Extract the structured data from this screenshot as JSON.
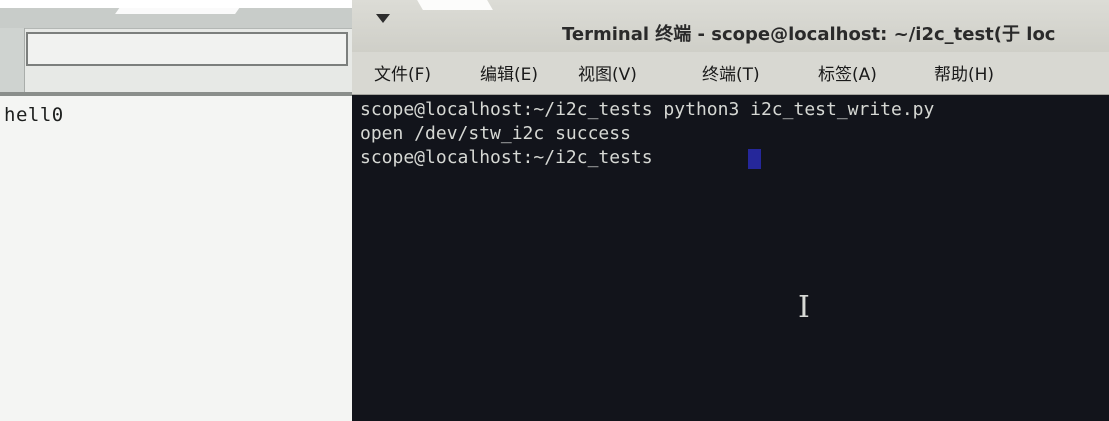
{
  "left_window": {
    "text": "hell0"
  },
  "terminal": {
    "title": "Terminal 终端 - scope@localhost: ~/i2c_test(于 loc",
    "menu": [
      {
        "label": "文件(F)"
      },
      {
        "label": "编辑(E)"
      },
      {
        "label": "视图(V)"
      },
      {
        "label": "终端(T)"
      },
      {
        "label": "标签(A)"
      },
      {
        "label": "帮助(H)"
      }
    ],
    "lines": [
      "scope@localhost:~/i2c_tests python3 i2c_test_write.py",
      "open /dev/stw_i2c success",
      "scope@localhost:~/i2c_tests "
    ],
    "cursor_color": "#25279a",
    "background_color": "#12141b",
    "text_color": "#d6d8d4"
  }
}
